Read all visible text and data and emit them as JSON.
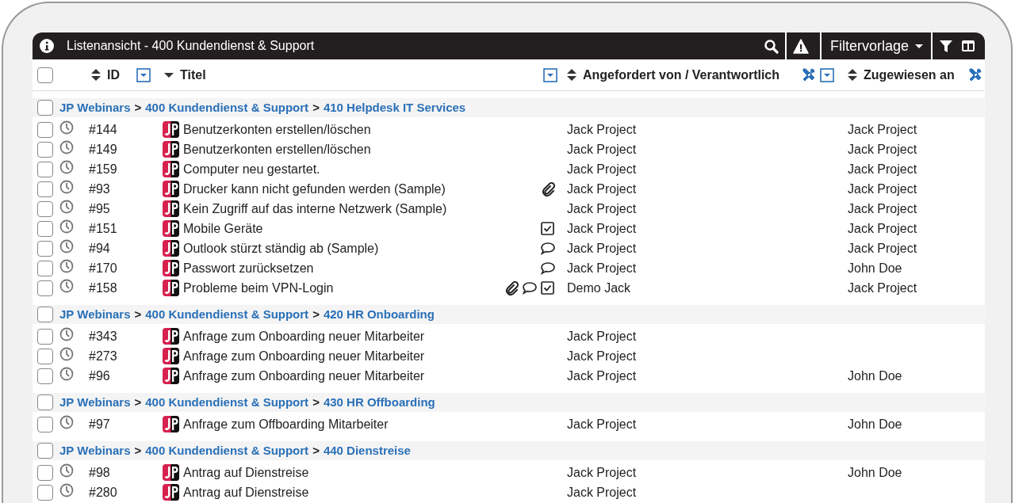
{
  "header": {
    "title": "Listenansicht - 400 Kundendienst & Support",
    "filter_template": "Filtervorlage"
  },
  "select_all": {
    "checked": false
  },
  "columns": [
    {
      "label": "ID",
      "sorted": false,
      "tools": false,
      "filter": true
    },
    {
      "label": "Titel",
      "sorted": true,
      "tools": false,
      "filter": true
    },
    {
      "label": "Angefordert von / Verantwortlich",
      "sorted": false,
      "tools": true,
      "filter": true
    },
    {
      "label": "Zugewiesen an",
      "sorted": false,
      "tools": true,
      "filter": false
    }
  ],
  "groups": [
    {
      "checked": false,
      "crumbs": [
        {
          "label": "JP Webinars"
        },
        {
          "sep": ">",
          "label": "400 Kundendienst & Support"
        },
        {
          "sep": ">",
          "label": "410 Helpdesk IT Services"
        }
      ],
      "rows": [
        {
          "checked": false,
          "id": "#144",
          "title": "Benutzerkonten erstellen/löschen",
          "indicators": [],
          "requested_by": "Jack Project",
          "assigned_to": "Jack Project"
        },
        {
          "checked": false,
          "id": "#149",
          "title": "Benutzerkonten erstellen/löschen",
          "indicators": [],
          "requested_by": "Jack Project",
          "assigned_to": "Jack Project"
        },
        {
          "checked": false,
          "id": "#159",
          "title": "Computer neu gestartet.",
          "indicators": [],
          "requested_by": "Jack Project",
          "assigned_to": "Jack Project"
        },
        {
          "checked": false,
          "id": "#93",
          "title": "Drucker kann nicht gefunden werden (Sample)",
          "indicators": [
            {
              "kind": "attachment"
            }
          ],
          "requested_by": "Jack Project",
          "assigned_to": "Jack Project"
        },
        {
          "checked": false,
          "id": "#95",
          "title": "Kein Zugriff auf das interne Netzwerk (Sample)",
          "indicators": [],
          "requested_by": "Jack Project",
          "assigned_to": "Jack Project"
        },
        {
          "checked": false,
          "id": "#151",
          "title": "Mobile Geräte",
          "indicators": [
            {
              "kind": "checklist"
            }
          ],
          "requested_by": "Jack Project",
          "assigned_to": "Jack Project"
        },
        {
          "checked": false,
          "id": "#94",
          "title": "Outlook stürzt ständig ab (Sample)",
          "indicators": [
            {
              "kind": "comment"
            }
          ],
          "requested_by": "Jack Project",
          "assigned_to": "Jack Project"
        },
        {
          "checked": false,
          "id": "#170",
          "title": "Passwort zurücksetzen",
          "indicators": [
            {
              "kind": "comment"
            }
          ],
          "requested_by": "Jack Project",
          "assigned_to": "John Doe"
        },
        {
          "checked": false,
          "id": "#158",
          "title": "Probleme beim VPN-Login",
          "indicators": [
            {
              "kind": "attachment"
            },
            {
              "kind": "comment"
            },
            {
              "kind": "checklist"
            }
          ],
          "requested_by": "Demo Jack",
          "assigned_to": "Jack Project"
        }
      ]
    },
    {
      "checked": false,
      "crumbs": [
        {
          "label": "JP Webinars"
        },
        {
          "sep": ">",
          "label": "400 Kundendienst & Support"
        },
        {
          "sep": ">",
          "label": "420 HR Onboarding"
        }
      ],
      "rows": [
        {
          "checked": false,
          "id": "#343",
          "title": "Anfrage zum Onboarding neuer Mitarbeiter",
          "indicators": [],
          "requested_by": "Jack Project"
        },
        {
          "checked": false,
          "id": "#273",
          "title": "Anfrage zum Onboarding neuer Mitarbeiter",
          "indicators": [],
          "requested_by": "Jack Project"
        },
        {
          "checked": false,
          "id": "#96",
          "title": "Anfrage zum Onboarding neuer Mitarbeiter",
          "indicators": [],
          "requested_by": "Jack Project",
          "assigned_to": "John Doe"
        }
      ]
    },
    {
      "checked": false,
      "crumbs": [
        {
          "label": "JP Webinars"
        },
        {
          "sep": ">",
          "label": "400 Kundendienst & Support"
        },
        {
          "sep": ">",
          "label": "430 HR Offboarding"
        }
      ],
      "rows": [
        {
          "checked": false,
          "id": "#97",
          "title": "Anfrage zum Offboarding Mitarbeiter",
          "indicators": [],
          "requested_by": "Jack Project",
          "assigned_to": "John Doe"
        }
      ]
    },
    {
      "checked": false,
      "crumbs": [
        {
          "label": "JP Webinars"
        },
        {
          "sep": ">",
          "label": "400 Kundendienst & Support"
        },
        {
          "sep": ">",
          "label": "440 Dienstreise"
        }
      ],
      "rows": [
        {
          "checked": false,
          "id": "#98",
          "title": "Antrag auf Dienstreise",
          "indicators": [],
          "requested_by": "Jack Project",
          "assigned_to": "John Doe"
        },
        {
          "checked": false,
          "id": "#280",
          "title": "Antrag auf Dienstreise",
          "indicators": [],
          "requested_by": "Jack Project"
        }
      ]
    }
  ]
}
